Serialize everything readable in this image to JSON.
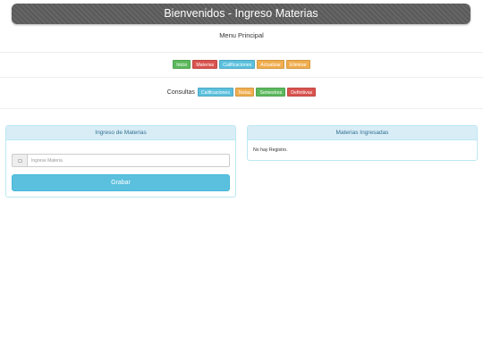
{
  "header": {
    "title": "Bienvenidos - Ingreso Materias"
  },
  "menu": {
    "title": "Menu Principal"
  },
  "nav": {
    "items": [
      {
        "label": "Inicio"
      },
      {
        "label": "Materias"
      },
      {
        "label": "Calificaciones"
      },
      {
        "label": "Actualizar"
      },
      {
        "label": "Eliminar"
      }
    ]
  },
  "consultas": {
    "label": "Consultas",
    "items": [
      {
        "label": "Calificaciones"
      },
      {
        "label": "Notas"
      },
      {
        "label": "Semestres"
      },
      {
        "label": "Definitivas"
      }
    ]
  },
  "ingreso_panel": {
    "title": "Ingreso de Materias",
    "input_placeholder": "Ingrese Materia",
    "input_value": "",
    "submit_label": "Grabar"
  },
  "materias_panel": {
    "title": "Materias Ingresadas",
    "empty_message": "No hay Registro."
  },
  "colors": {
    "success": "#5cb85c",
    "danger": "#d9534f",
    "info": "#5bc0de",
    "warning": "#f0ad4e",
    "panel_heading_bg": "#d9edf7",
    "panel_heading_text": "#31708f"
  }
}
